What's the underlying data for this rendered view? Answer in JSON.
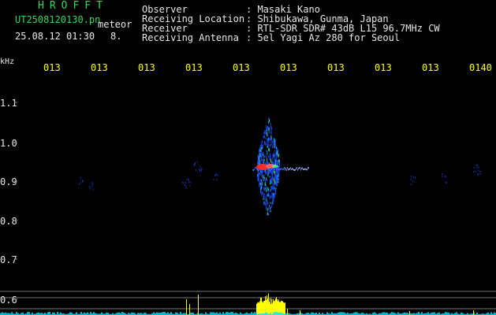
{
  "header": {
    "app_name": "HROFFT",
    "filename": "UT2508120130.pn",
    "event_type": "meteor",
    "datetime": "25.08.12 01:30",
    "count": "8.",
    "info": [
      {
        "label": "Observer",
        "value": ": Masaki Kano"
      },
      {
        "label": "Receiving Location",
        "value": ": Shibukawa, Gunma, Japan"
      },
      {
        "label": "Receiver",
        "value": ": RTL-SDR SDR# 43dB L15 96.7MHz CW"
      },
      {
        "label": "Receiving Antenna",
        "value": ": 5el Yagi Az 280 for Seoul"
      }
    ]
  },
  "axis": {
    "unit": "kHz",
    "y_ticks": [
      "1.1",
      "1.0",
      "0.9",
      "0.8",
      "0.7",
      "0.6"
    ],
    "x_ticks": [
      "013",
      "013",
      "013",
      "013",
      "013",
      "013",
      "013",
      "013",
      "013",
      "0140"
    ]
  },
  "colors": {
    "background": "#000000",
    "text_green": "#37d65a",
    "text_white": "#e8e8e8",
    "time_yellow": "#ffff00",
    "signal_blue": "#1e4bff",
    "signal_hot": "#ff2a2a",
    "power_yellow": "#ffff00",
    "power_cyan": "#00e5ff"
  }
}
